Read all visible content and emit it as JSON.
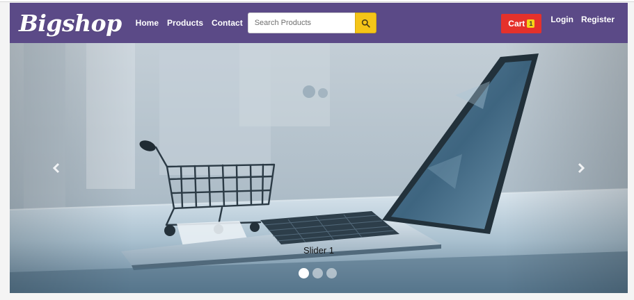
{
  "brand": {
    "name": "Bigshop"
  },
  "nav": {
    "links": [
      {
        "label": "Home"
      },
      {
        "label": "Products"
      },
      {
        "label": "Contact"
      }
    ]
  },
  "search": {
    "placeholder": "Search Products",
    "value": "",
    "button_icon": "search-icon"
  },
  "cart": {
    "label": "Cart",
    "count": "1"
  },
  "auth": {
    "login": "Login",
    "register": "Register"
  },
  "carousel": {
    "caption": "Slider 1",
    "slides": 3,
    "active_slide": 1,
    "prev_icon": "chevron-left-icon",
    "next_icon": "chevron-right-icon"
  },
  "colors": {
    "navbar": "#5b4a87",
    "cart_button": "#e5312b",
    "cart_badge": "#f5d418",
    "search_button": "#f5c518"
  }
}
